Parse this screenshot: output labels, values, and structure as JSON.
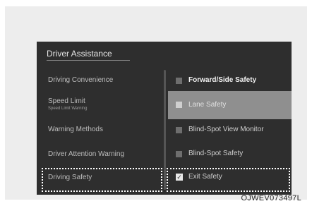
{
  "screen": {
    "title": "Driver Assistance",
    "left_menu": [
      {
        "label": "Driving Convenience",
        "sub": ""
      },
      {
        "label": "Speed Limit",
        "sub": "Speed Limit Warning"
      },
      {
        "label": "Warning Methods",
        "sub": ""
      },
      {
        "label": "Driver Attention Warning",
        "sub": ""
      },
      {
        "label": "Driving Safety",
        "sub": ""
      }
    ],
    "right_menu": [
      {
        "label": "Forward/Side Safety"
      },
      {
        "label": "Lane Safety"
      },
      {
        "label": "Blind-Spot View Monitor"
      },
      {
        "label": "Blind-Spot Safety"
      },
      {
        "label": "Exit Safety",
        "checked": true
      }
    ],
    "checkmark": "✓"
  },
  "figure_ref": "OJWEV073497L"
}
